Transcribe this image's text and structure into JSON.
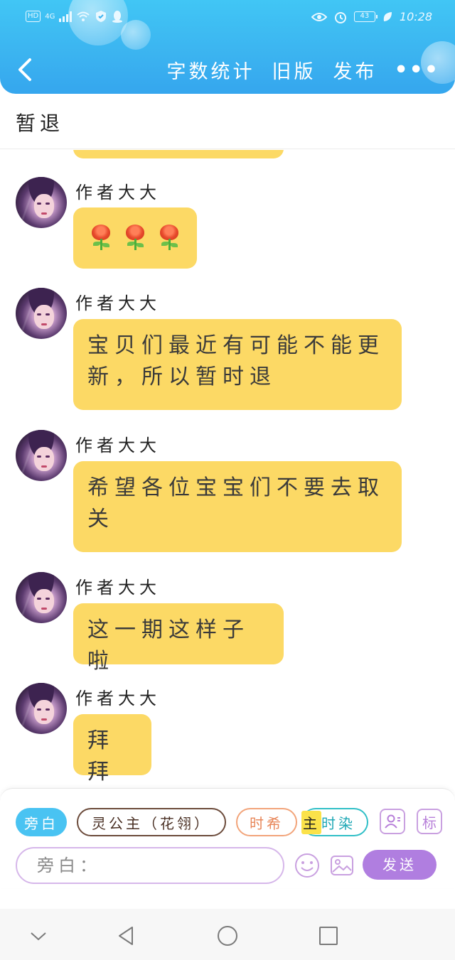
{
  "status_bar": {
    "left_badges": [
      "HD",
      "4G"
    ],
    "battery": "43",
    "time": "10:28"
  },
  "nav": {
    "back_icon": "chevron-left-icon",
    "word_count": "字数统计",
    "old_version": "旧版",
    "publish": "发布",
    "more": "•••"
  },
  "title": "暂退",
  "messages": [
    {
      "author": "作者大大",
      "type": "emoji",
      "content": "🌹🌹🌹",
      "emoji_icons": [
        "rose-icon",
        "rose-icon",
        "rose-icon"
      ]
    },
    {
      "author": "作者大大",
      "type": "text",
      "content": "宝贝们最近有可能不能更新，所以暂时退"
    },
    {
      "author": "作者大大",
      "type": "text",
      "content": "希望各位宝宝们不要去取关"
    },
    {
      "author": "作者大大",
      "type": "text",
      "content": "这一期这样子啦"
    },
    {
      "author": "作者大大",
      "type": "text",
      "content": "拜拜"
    }
  ],
  "input_panel": {
    "chips": {
      "narration": "旁白",
      "role1": "灵公主（花翎）",
      "role2": "时希",
      "role3_highlight": "主",
      "role3_rest": "时染"
    },
    "icon_buttons": {
      "role_icon": "user-card-icon",
      "tag_label": "标"
    },
    "input_placeholder": "旁白：",
    "emoji_icon": "smiley-icon",
    "image_icon": "image-icon",
    "send_label": "发送"
  },
  "colors": {
    "header": "#3bb3f0",
    "bubble": "#fcd965",
    "narration_chip": "#49c3f2",
    "send_button": "#b07ee0"
  }
}
